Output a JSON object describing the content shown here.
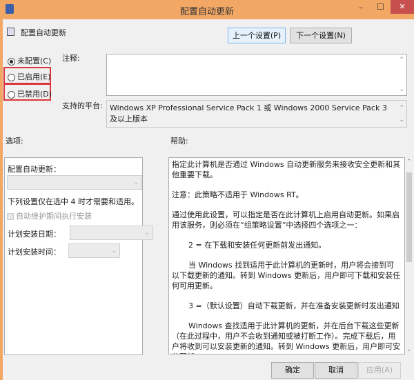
{
  "window": {
    "title": "配置自动更新",
    "minimize": "–",
    "maximize": "☐",
    "close": "✕"
  },
  "header": {
    "policy_name": "配置自动更新",
    "prev_button": "上一个设置(P)",
    "next_button": "下一个设置(N)"
  },
  "state": {
    "options": [
      {
        "label": "未配置(C)",
        "selected": true
      },
      {
        "label": "已启用(E)",
        "selected": false
      },
      {
        "label": "已禁用(D)",
        "selected": false
      }
    ]
  },
  "comment": {
    "label": "注释:",
    "value": ""
  },
  "platform": {
    "label": "支持的平台:",
    "value": "Windows XP Professional Service Pack 1 或 Windows 2000 Service Pack 3 及以上版本"
  },
  "options_pane": {
    "label": "选项:",
    "configure_label": "配置自动更新：",
    "configure_value": "",
    "note": "下列设置仅在选中 4 时才需要和适用。",
    "maintenance_checkbox": "自动维护期间执行安装",
    "day_label": "计划安装日期：",
    "time_label": "计划安装时间："
  },
  "help_pane": {
    "label": "帮助:",
    "paragraphs": [
      "指定此计算机是否通过 Windows 自动更新服务来接收安全更新和其他重要下载。",
      "注意：此策略不适用于 Windows RT。",
      "通过使用此设置，可以指定是否在此计算机上启用自动更新。如果启用该服务，则必须在“组策略设置”中选择四个选项之一：",
      "2 = 在下载和安装任何更新前发出通知。",
      "当 Windows 找到适用于此计算机的更新时，用户将会接到可以下载更新的通知。转到 Windows 更新后，用户即可下载和安装任何可用更新。",
      "3 =（默认设置）自动下载更新，并在准备安装更新时发出通知",
      "Windows 查找适用于此计算机的更新，并在后台下载这些更新（在此过程中，用户不会收到通知或被打断工作）。完成下载后，用户将收到可以安装更新的通知。转到 Windows 更新后，用户即可安装更新。"
    ]
  },
  "footer": {
    "ok": "确定",
    "cancel": "取消",
    "apply": "应用(A)"
  }
}
